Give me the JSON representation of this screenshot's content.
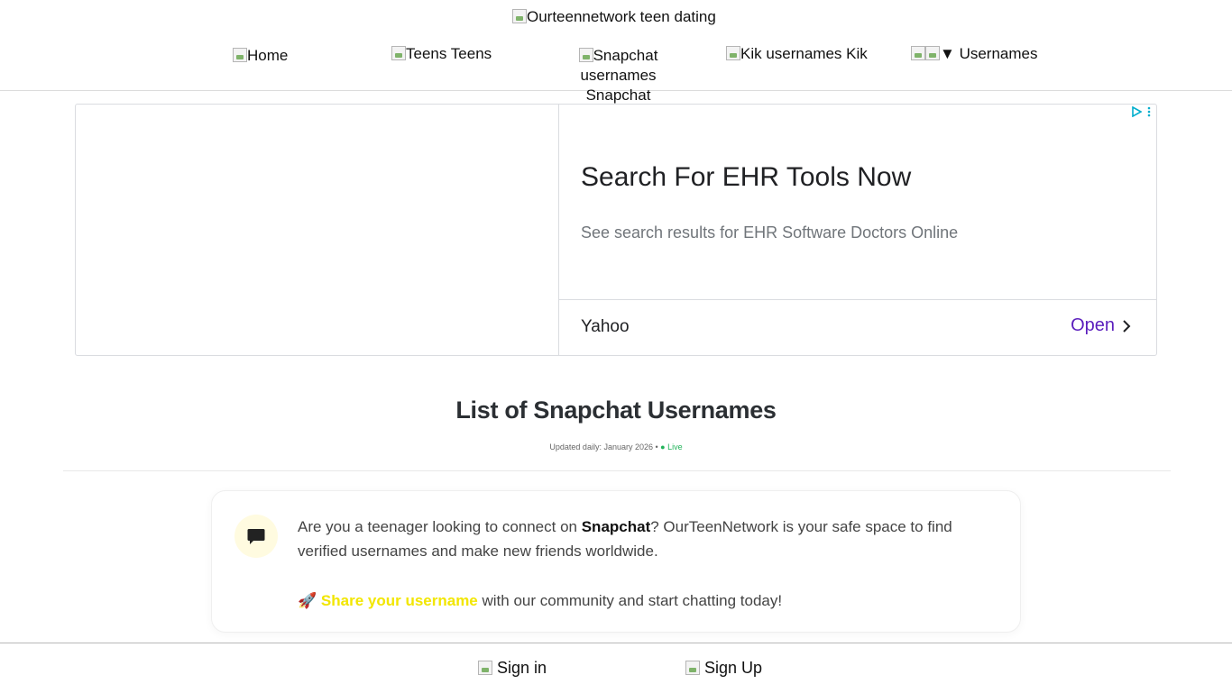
{
  "header": {
    "logo_alt": "Ourteennetwork teen dating",
    "nav": {
      "home_alt": "Home",
      "teens_alt": "Teens",
      "teens_label": "Teens",
      "snapchat_alt": "Snapchat usernames",
      "snapchat_label": "Snapchat",
      "kik_alt": "Kik usernames",
      "kik_label": "Kik",
      "usernames_caret": "▼",
      "usernames_label": "Usernames"
    }
  },
  "ad": {
    "title": "Search For EHR Tools Now",
    "description": "See search results for EHR Software Doctors Online",
    "advertiser": "Yahoo",
    "cta": "Open",
    "accent_color": "#5b1ebd",
    "choices_color": "#00aecd"
  },
  "main": {
    "title": "List of Snapchat Usernames",
    "updated_prefix": "Updated daily: January 2026 • ",
    "live_label": "● Live",
    "info": {
      "text_before": "Are you a teenager looking to connect on ",
      "text_bold": "Snapchat",
      "text_after": "? OurTeenNetwork is your safe space to find verified usernames and make new friends worldwide.",
      "share_icon": "rocket-icon",
      "share_emoji": "🚀",
      "share_link": "Share your username",
      "share_rest": " with our community and start chatting today!"
    }
  },
  "footer": {
    "signin_label": "Sign in",
    "signup_label": "Sign Up"
  }
}
